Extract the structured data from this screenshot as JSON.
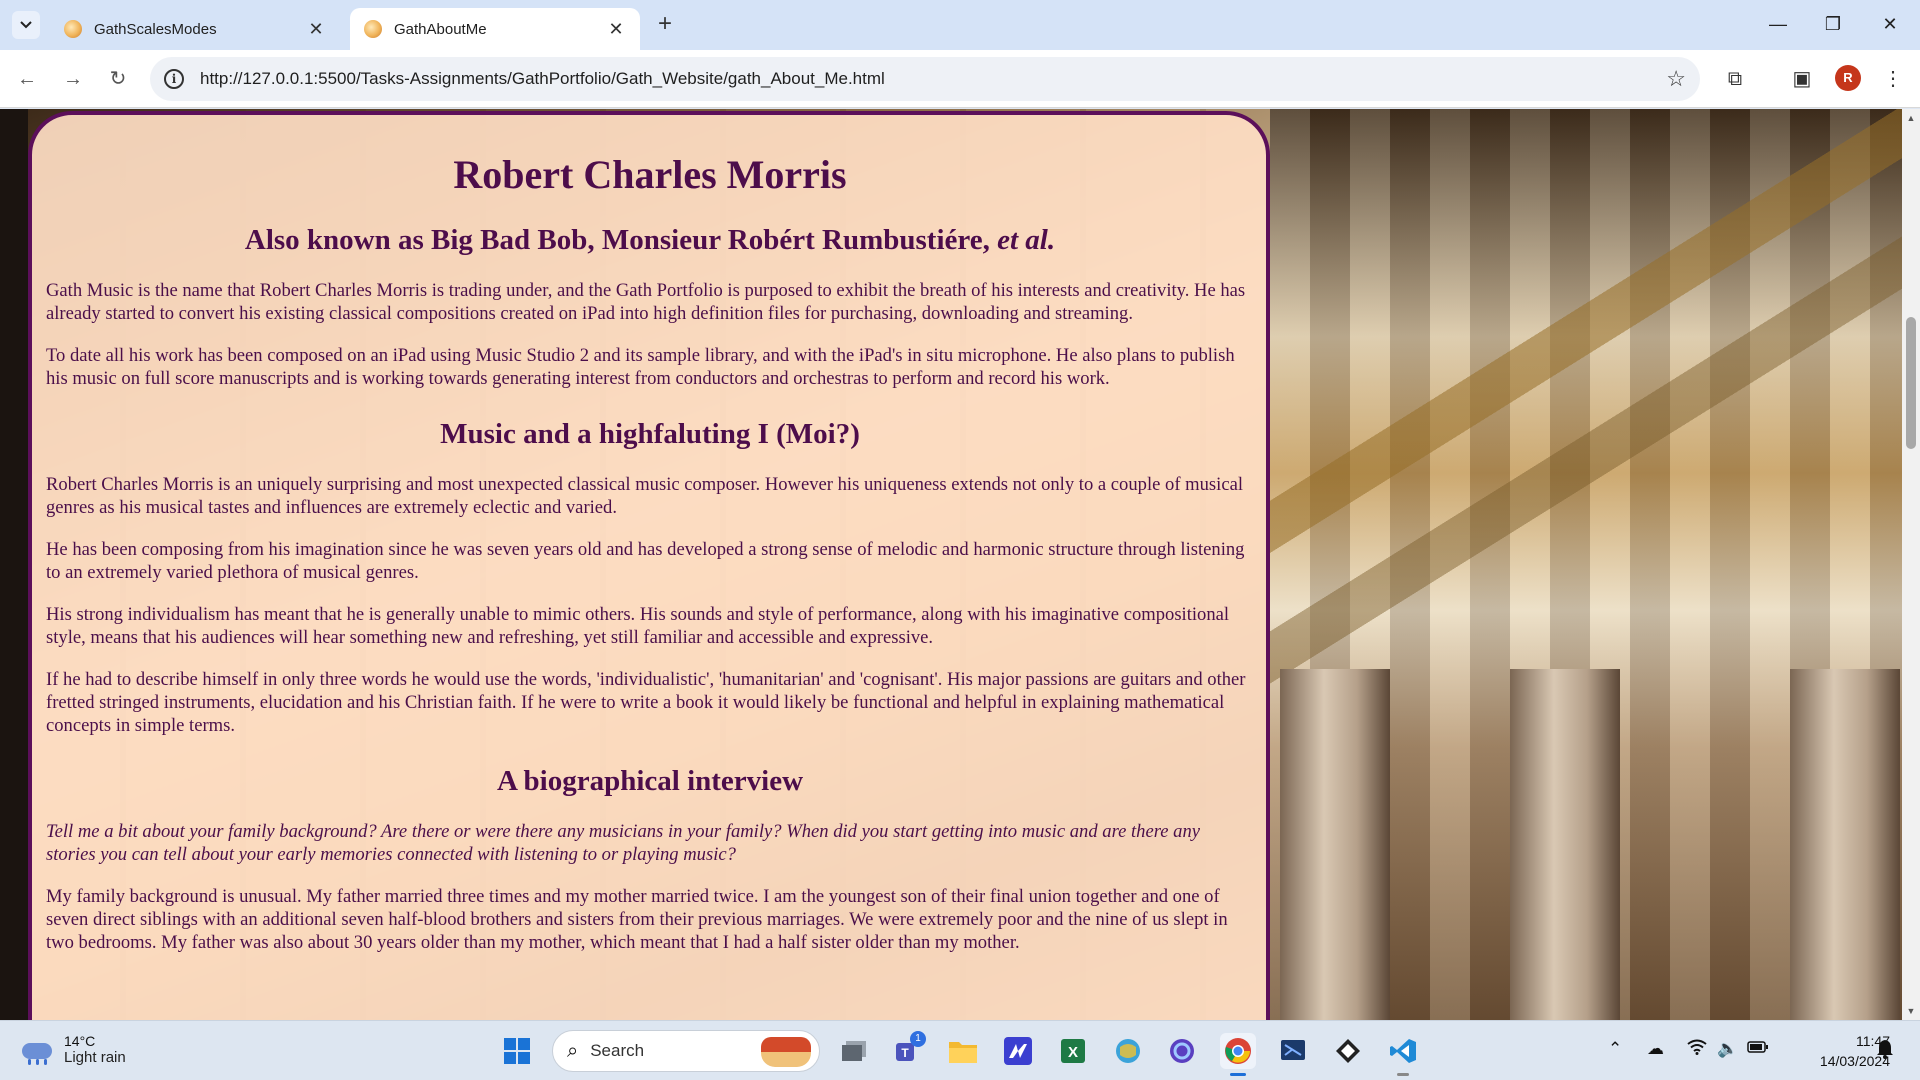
{
  "browser": {
    "tabs": [
      {
        "title": "GathScalesModes",
        "active": false
      },
      {
        "title": "GathAboutMe",
        "active": true
      }
    ],
    "url": "http://127.0.0.1:5500/Tasks-Assignments/GathPortfolio/Gath_Website/gath_About_Me.html",
    "profile_initial": "R"
  },
  "page": {
    "title": "Robert Charles Morris",
    "aka_prefix": "Also known as Big Bad Bob, Monsieur Robért Rumbustiére, ",
    "aka_italic": "et al.",
    "intro_p1": "Gath Music is the name that Robert Charles Morris is trading under, and the Gath Portfolio is purposed to exhibit the breath of his interests and creativity. He has already started to convert his existing classical compositions created on iPad into high definition files for purchasing, downloading and streaming.",
    "intro_p2": "To date all his work has been composed on an iPad using Music Studio 2 and its sample library, and with the iPad's in situ microphone. He also plans to publish his music on full score manuscripts and is working towards generating interest from conductors and orchestras to perform and record his work.",
    "section1_heading": "Music and a highfaluting I (Moi?)",
    "section1_p1": "Robert Charles Morris is an uniquely surprising and most unexpected classical music composer. However his uniqueness extends not only to a couple of musical genres as his musical tastes and influences are extremely eclectic and varied.",
    "section1_p2": "He has been composing from his imagination since he was seven years old and has developed a strong sense of melodic and harmonic structure through listening to an extremely varied plethora of musical genres.",
    "section1_p3": "His strong individualism has meant that he is generally unable to mimic others. His sounds and style of performance, along with his imaginative compositional style, means that his audiences will hear something new and refreshing, yet still familiar and accessible and expressive.",
    "section1_p4": "If he had to describe himself in only three words he would use the words, 'individualistic', 'humanitarian' and 'cognisant'. His major passions are guitars and other fretted stringed instruments, elucidation and his Christian faith. If he were to write a book it would likely be functional and helpful in explaining mathematical concepts in simple terms.",
    "section2_heading": "A biographical interview",
    "question1": "Tell me a bit about your family background? Are there or were there any musicians in your family? When did you start getting into music and are there any stories you can tell about your early memories connected with listening to or playing music?",
    "answer1": "My family background is unusual. My father married three times and my mother married twice. I am the youngest son of their final union together and one of seven direct siblings with an additional seven half-blood brothers and sisters from their previous marriages. We were extremely poor and the nine of us slept in two bedrooms. My father was also about 30 years older than my mother, which meant that I had a half sister older than my mother."
  },
  "taskbar": {
    "temperature": "14°C",
    "weather": "Light rain",
    "search_placeholder": "Search",
    "teams_badge": "1",
    "time": "11:47",
    "date": "14/03/2024"
  }
}
